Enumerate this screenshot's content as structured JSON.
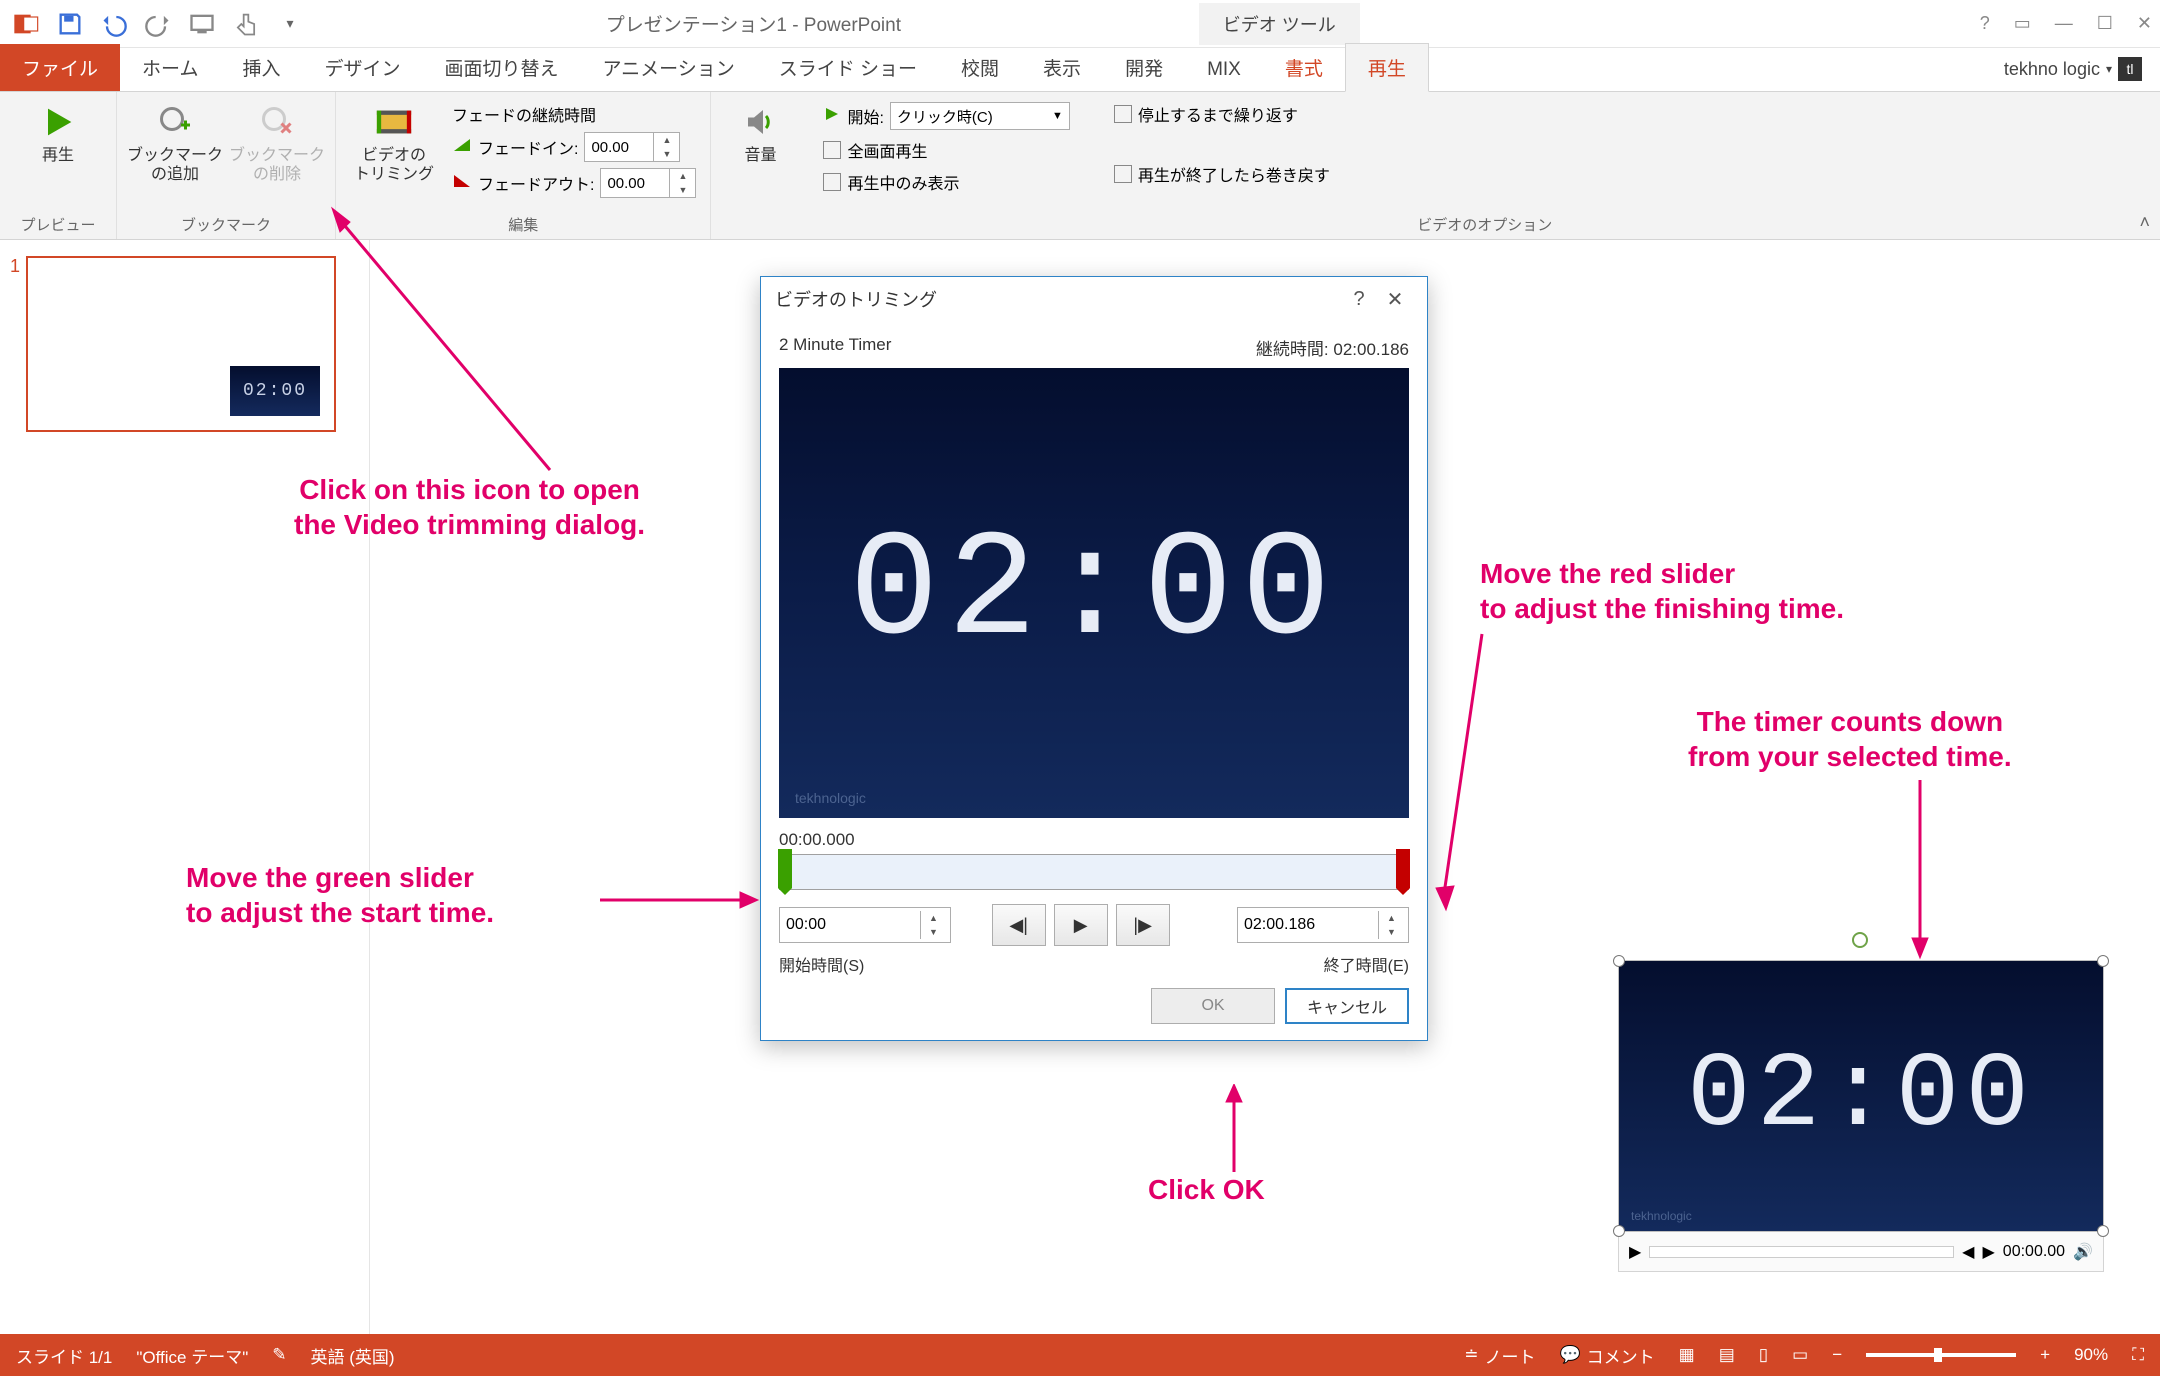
{
  "app": {
    "title": "プレゼンテーション1 - PowerPoint",
    "video_tools_tab": "ビデオ ツール",
    "user": "tekhno logic",
    "avatar_letters": "tl"
  },
  "qat": {
    "save": "save",
    "undo": "undo",
    "redo": "redo",
    "start": "start",
    "touch": "touch",
    "more": "more"
  },
  "tabs": {
    "file": "ファイル",
    "home": "ホーム",
    "insert": "挿入",
    "design": "デザイン",
    "transitions": "画面切り替え",
    "animations": "アニメーション",
    "slideshow": "スライド ショー",
    "review": "校閲",
    "view": "表示",
    "developer": "開発",
    "mix": "MIX",
    "format": "書式",
    "playback": "再生"
  },
  "ribbon": {
    "preview": {
      "play": "再生",
      "group": "プレビュー"
    },
    "bookmark": {
      "add": "ブックマーク\nの追加",
      "remove": "ブックマーク\nの削除",
      "group": "ブックマーク"
    },
    "edit": {
      "trim": "ビデオの\nトリミング",
      "fade_duration": "フェードの継続時間",
      "fade_in": "フェードイン:",
      "fade_out": "フェードアウト:",
      "fade_in_val": "00.00",
      "fade_out_val": "00.00",
      "group": "編集"
    },
    "volume": {
      "label": "音量"
    },
    "options": {
      "start_label": "開始:",
      "start_value": "クリック時(C)",
      "fullscreen": "全画面再生",
      "hide": "再生中のみ表示",
      "loop": "停止するまで繰り返す",
      "rewind": "再生が終了したら巻き戻す",
      "group": "ビデオのオプション"
    }
  },
  "thumb": {
    "number": "1",
    "mini_time": "02:00"
  },
  "dialog": {
    "title": "ビデオのトリミング",
    "help": "?",
    "close": "✕",
    "clip": "2 Minute Timer",
    "duration_label": "継続時間:",
    "duration_value": "02:00.186",
    "display_time": "02:00",
    "brand": "tekhnologic",
    "current_pos": "00:00.000",
    "start_value": "00:00",
    "end_value": "02:00.186",
    "start_label": "開始時間(S)",
    "end_label": "終了時間(E)",
    "ok": "OK",
    "cancel": "キャンセル"
  },
  "annotations": {
    "trim_hint": "Click on this icon to open\nthe Video trimming dialog.",
    "green_hint": "Move the green slider\nto adjust the start time.",
    "red_hint": "Move the red slider\nto adjust the finishing time.",
    "timer_hint": "The timer counts down\nfrom your selected time.",
    "ok_hint": "Click OK"
  },
  "slidevideo": {
    "display": "02:00",
    "position": "00:00.00",
    "brand": "tekhnologic"
  },
  "status": {
    "slide": "スライド 1/1",
    "theme": "\"Office テーマ\"",
    "lang": "英語 (英国)",
    "notes": "ノート",
    "comments": "コメント",
    "zoom": "90%"
  }
}
